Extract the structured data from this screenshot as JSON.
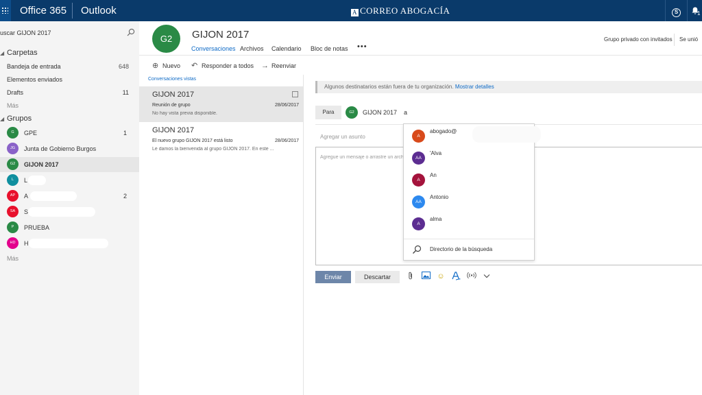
{
  "topbar": {
    "suite": "Office 365",
    "app": "Outlook",
    "brand_mark": "A",
    "brand": "CORREO ABOGACÍA",
    "skype_glyph": "S",
    "notification_badge": "1"
  },
  "search": {
    "placeholder": "uscar GIJON 2017"
  },
  "folders": {
    "header": "Carpetas",
    "items": [
      {
        "label": "Bandeja de entrada",
        "count": "648"
      },
      {
        "label": "Elementos enviados",
        "count": ""
      },
      {
        "label": "Drafts",
        "count": "11"
      }
    ],
    "more": "Más"
  },
  "groups": {
    "header": "Grupos",
    "items": [
      {
        "initials": "G",
        "label": "GPE",
        "count": "1",
        "color": "#2a8a46"
      },
      {
        "initials": "JG",
        "label": "Junta de Gobierno Burgos",
        "count": "",
        "color": "#8a62c8"
      },
      {
        "initials": "G2",
        "label": "GIJON 2017",
        "count": "",
        "color": "#2a8a46"
      },
      {
        "initials": "L",
        "label": "L",
        "count": "",
        "color": "#0f8f9f"
      },
      {
        "initials": "AP",
        "label": "A",
        "count": "2",
        "color": "#e8112d"
      },
      {
        "initials": "SA",
        "label": "S",
        "count": "",
        "color": "#e8112d"
      },
      {
        "initials": "P",
        "label": "PRUEBA",
        "count": "",
        "color": "#2a8a46"
      },
      {
        "initials": "HD",
        "label": "H",
        "count": "",
        "color": "#e3008c"
      }
    ],
    "more": "Más"
  },
  "group_header": {
    "initials": "G2",
    "title": "GIJON 2017",
    "tabs": [
      "Conversaciones",
      "Archivos",
      "Calendario",
      "Bloc de notas"
    ],
    "more": "•••",
    "privacy": "Grupo privado con invitados",
    "follow": "Se unió"
  },
  "toolbar": {
    "new": "Nuevo",
    "reply_all": "Responder a todos",
    "forward": "Reenviar"
  },
  "list": {
    "title": "Conversaciones vistas",
    "conversations": [
      {
        "title": "GIJON 2017",
        "subtitle": "Reunión de grupo",
        "date": "28/06/2017",
        "preview": "No hay vista previa disponible."
      },
      {
        "title": "GIJON 2017",
        "subtitle": "El nuevo grupo GIJON 2017 está listo",
        "date": "28/06/2017",
        "preview": "Le damos la bienvenida al grupo GIJON 2017. En este ..."
      }
    ]
  },
  "compose": {
    "warning": "Algunos destinatarios están fuera de tu organización.",
    "warning_link": "Mostrar detalles",
    "to_label": "Para",
    "to_initials": "G2",
    "to_name": "GIJON 2017",
    "to_typed": "a",
    "subject_placeholder": "Agregar un asunto",
    "body_placeholder": "Agregue un mensaje o arrastre un archivo aquí",
    "send": "Enviar",
    "discard": "Descartar"
  },
  "suggestions": {
    "items": [
      {
        "initials": "A",
        "name": "abogado@",
        "color": "#d84a1b"
      },
      {
        "initials": "AA",
        "name": "'Alva",
        "color": "#5c2d91"
      },
      {
        "initials": "A",
        "name": "An",
        "color": "#a4133c"
      },
      {
        "initials": "AA",
        "name": "Antonio",
        "color": "#2d89ef"
      },
      {
        "initials": "A",
        "name": "alma",
        "color": "#5c2d91"
      }
    ],
    "search_directory": "Directorio de la búsqueda"
  },
  "colors": {
    "topbar": "#0a3a6a",
    "accent": "#0e6ac6",
    "send_button": "#6d86a9"
  }
}
